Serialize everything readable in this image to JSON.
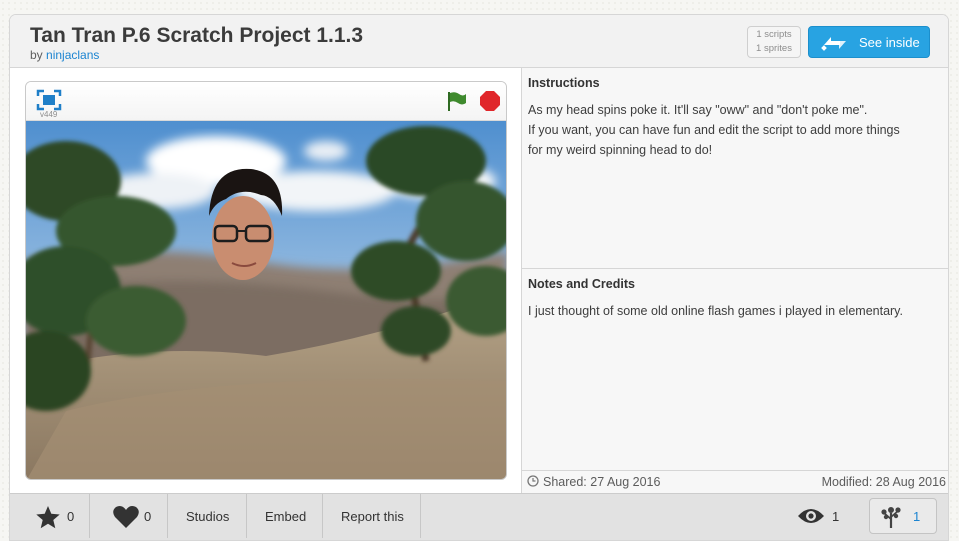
{
  "project": {
    "title": "Tan Tran P.6 Scratch Project 1.1.3",
    "by_prefix": "by",
    "author": "ninjaclans"
  },
  "stats": {
    "scripts": "1 scripts",
    "sprites": "1 sprites"
  },
  "see_inside": {
    "label": "See inside",
    "icon": "swap-arrows-icon"
  },
  "player": {
    "version": "v449",
    "icons": [
      "fullscreen-icon",
      "green-flag-icon",
      "stop-icon"
    ],
    "colors": {
      "flag": "#3f8a2e",
      "stop": "#e0262a"
    }
  },
  "instructions": {
    "title": "Instructions",
    "lines": [
      "As my head spins poke it. It'll say \"oww\" and \"don't poke me\".",
      "If you want, you can have fun and edit the script to add more things",
      "for my weird spinning head to do!"
    ]
  },
  "notes": {
    "title": "Notes and Credits",
    "lines": [
      "I just thought of some old online flash games i played in elementary."
    ]
  },
  "dates": {
    "shared": "Shared: 27 Aug 2016",
    "modified": "Modified: 28 Aug 2016"
  },
  "actions": {
    "favorites_count": "0",
    "loves_count": "0",
    "studios_label": "Studios",
    "embed_label": "Embed",
    "report_label": "Report this",
    "views_count": "1",
    "remix_count": "1"
  },
  "colors": {
    "accent": "#28a3e2",
    "link": "#1b84d1"
  }
}
